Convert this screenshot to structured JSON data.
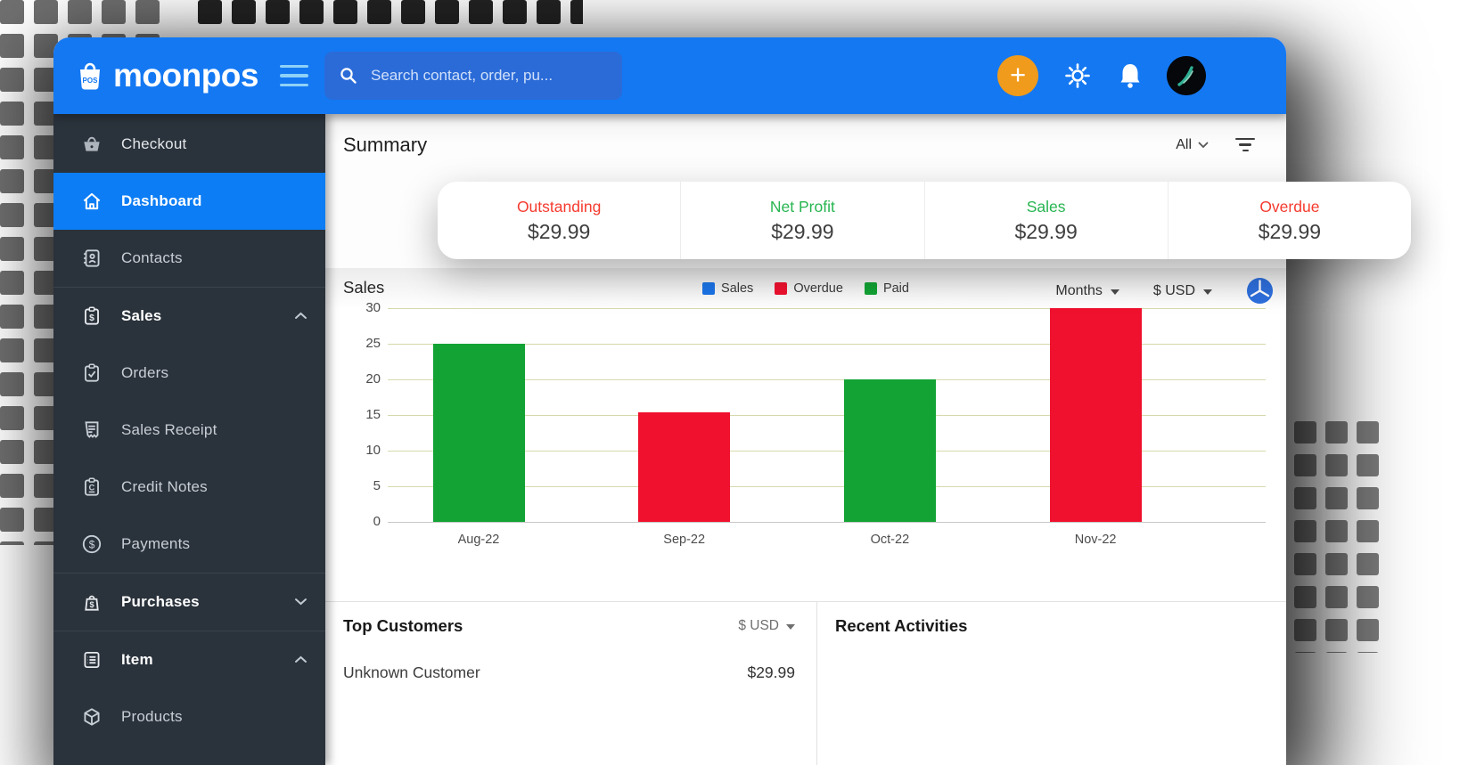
{
  "topbar": {
    "brand": "moonpos",
    "add_symbol": "+",
    "search": {
      "placeholder": "Search contact, order, pu..."
    }
  },
  "sidebar": {
    "items": [
      {
        "label": "Checkout",
        "icon": "basket-icon",
        "active": false
      },
      {
        "label": "Dashboard",
        "icon": "home-icon",
        "active": true
      },
      {
        "label": "Contacts",
        "icon": "contacts-book-icon",
        "active": false
      },
      {
        "label": "Sales",
        "icon": "sales-clipboard-icon",
        "active": false,
        "chevron": "up"
      },
      {
        "label": "Orders",
        "icon": "orders-clipboard-icon",
        "active": false
      },
      {
        "label": "Sales Receipt",
        "icon": "receipt-icon",
        "active": false
      },
      {
        "label": "Credit Notes",
        "icon": "credit-note-icon",
        "active": false
      },
      {
        "label": "Payments",
        "icon": "payments-dollar-icon",
        "active": false
      },
      {
        "label": "Purchases",
        "icon": "purchases-bag-icon",
        "active": false,
        "chevron": "down"
      },
      {
        "label": "Item",
        "icon": "item-list-icon",
        "active": false,
        "chevron": "up"
      },
      {
        "label": "Products",
        "icon": "products-box-icon",
        "active": false
      }
    ]
  },
  "summary": {
    "title": "Summary",
    "range_label": "All",
    "cards": [
      {
        "label": "Outstanding",
        "value": "$29.99",
        "color": "#f53a2e"
      },
      {
        "label": "Net Profit",
        "value": "$29.99",
        "color": "#27b551"
      },
      {
        "label": "Sales",
        "value": "$29.99",
        "color": "#27b551"
      },
      {
        "label": "Overdue",
        "value": "$29.99",
        "color": "#f53a2e"
      }
    ]
  },
  "chart_header": {
    "title": "Sales",
    "interval_label": "Months",
    "currency_label": "$ USD"
  },
  "chart_data": {
    "type": "bar",
    "title": "Sales",
    "categories": [
      "Aug-22",
      "Sep-22",
      "Oct-22",
      "Nov-22"
    ],
    "values": [
      25,
      15.4,
      20,
      30
    ],
    "bar_colors": [
      "#12a334",
      "#f0112f",
      "#12a334",
      "#f0112f"
    ],
    "legend": [
      {
        "label": "Sales",
        "color": "#1b74e8"
      },
      {
        "label": "Overdue",
        "color": "#f0112f"
      },
      {
        "label": "Paid",
        "color": "#12a334"
      }
    ],
    "xlabel": "",
    "ylabel": "",
    "ylim": [
      0,
      30
    ],
    "ytick_step": 5,
    "grid": true,
    "gridline_color": "#d6d9ac",
    "legend_position": "top-center"
  },
  "top_customers": {
    "title": "Top Customers",
    "currency_label": "$ USD",
    "rows": [
      {
        "name": "Unknown Customer",
        "amount": "$29.99"
      }
    ]
  },
  "recent_activities": {
    "title": "Recent Activities"
  }
}
